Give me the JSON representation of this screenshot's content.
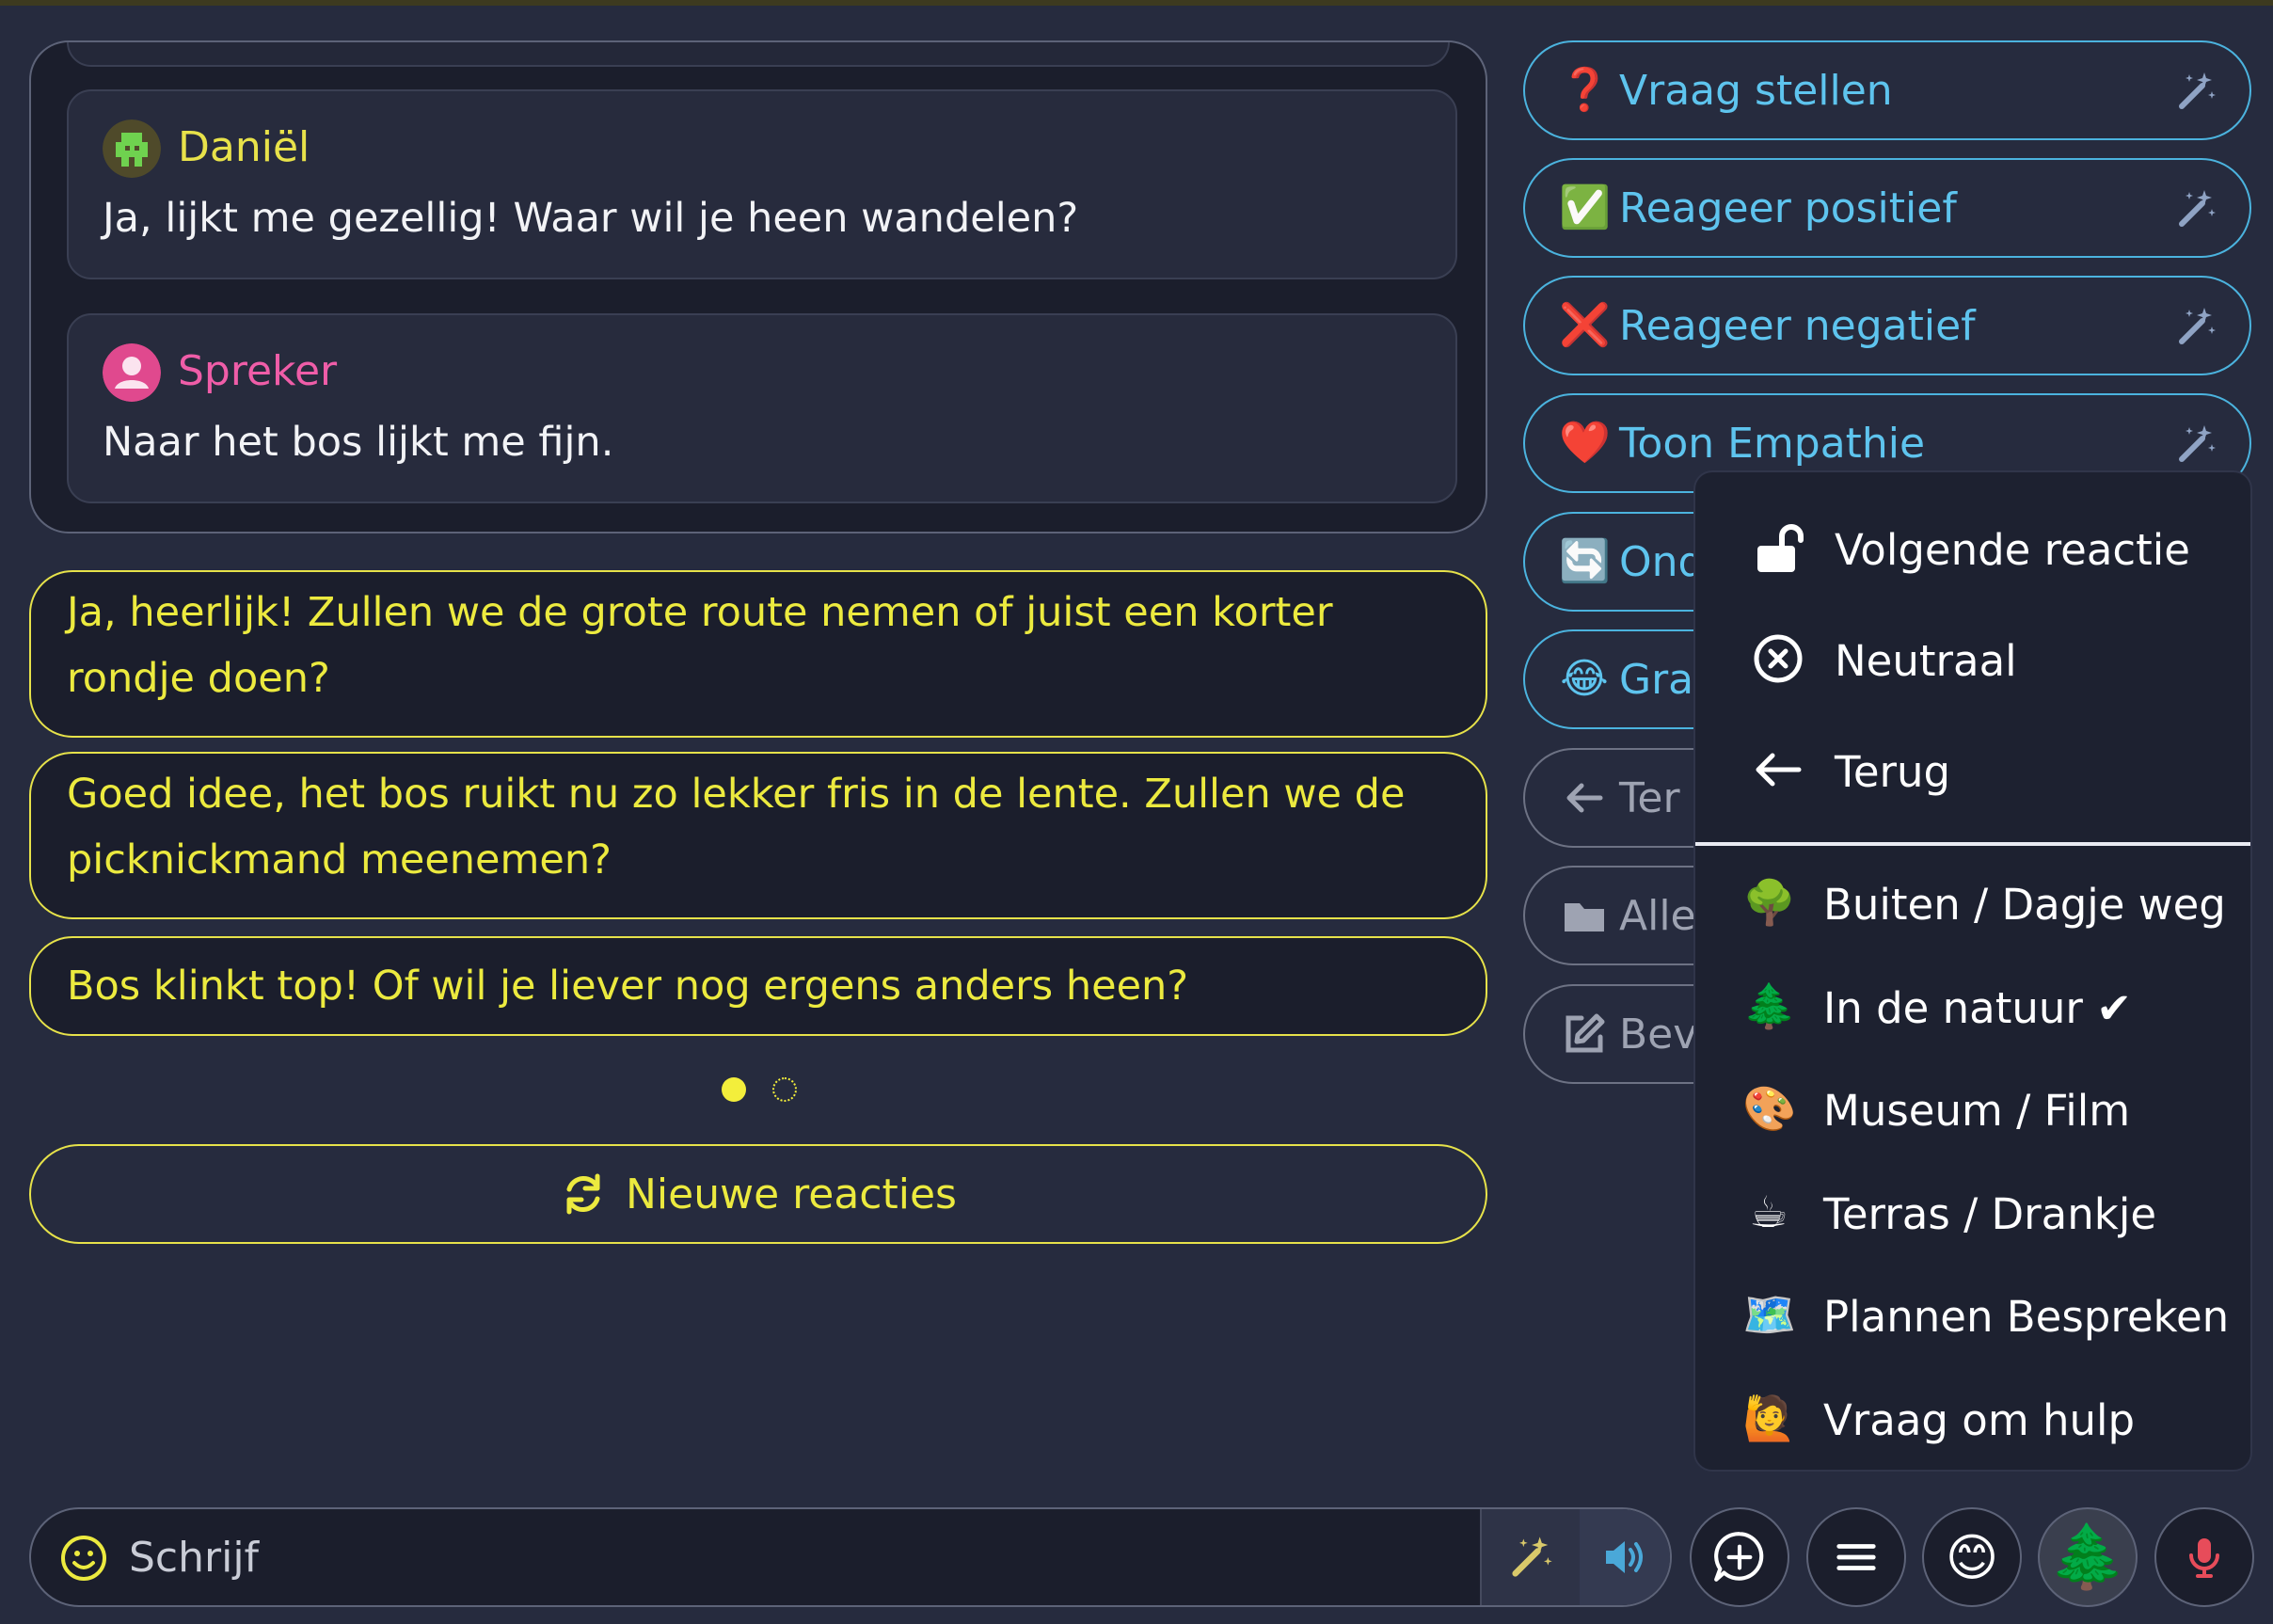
{
  "history": [
    {
      "name": "Daniël",
      "text": "Ja, lijkt me gezellig! Waar wil je heen wandelen?",
      "name_color": "#e8e24a"
    },
    {
      "name": "Spreker",
      "text": "Naar het bos lijkt me fijn.",
      "name_color": "#ef5da8"
    }
  ],
  "suggestions": [
    "Ja, heerlijk! Zullen we de grote route nemen of juist een korter rondje doen?",
    "Goed idee, het bos ruikt nu zo lekker fris in de lente. Zullen we de picknickmand meenemen?",
    "Bos klinkt top! Of wil je liever nog ergens anders heen?"
  ],
  "pager": {
    "current": 1,
    "total": 2
  },
  "new_replies_label": "Nieuwe reacties",
  "actions": [
    {
      "icon": "question-icon",
      "glyph": "❓",
      "label": "Vraag stellen",
      "magic": true
    },
    {
      "icon": "check-icon",
      "glyph": "✅",
      "label": "Reageer positief",
      "magic": true
    },
    {
      "icon": "cross-icon",
      "glyph": "❌",
      "label": "Reageer negatief",
      "magic": true
    },
    {
      "icon": "heart-icon",
      "glyph": "❤️",
      "label": "Toon Empathie",
      "magic": true
    },
    {
      "icon": "repeat-icon",
      "glyph": "🔄",
      "label": "Ond",
      "magic": false
    },
    {
      "icon": "laugh-icon",
      "glyph": "😂",
      "label": "Grap",
      "magic": false
    },
    {
      "icon": "arrow-left-icon",
      "glyph": "",
      "label": "Ter",
      "magic": false
    },
    {
      "icon": "folder-icon",
      "glyph": "",
      "label": "Alle",
      "magic": false
    },
    {
      "icon": "edit-icon",
      "glyph": "",
      "label": "Bev",
      "magic": false
    }
  ],
  "menu": {
    "top_items": [
      {
        "icon": "unlock-icon",
        "label": "Volgende reactie"
      },
      {
        "icon": "circle-x-icon",
        "label": "Neutraal"
      },
      {
        "icon": "arrow-left-icon",
        "label": "Terug"
      }
    ],
    "topics": [
      {
        "icon": "tree-icon",
        "glyph": "🌳",
        "label": "Buiten / Dagje weg"
      },
      {
        "icon": "evergreen-icon",
        "glyph": "🌲",
        "label": "In de natuur ✔"
      },
      {
        "icon": "palette-icon",
        "glyph": "🎨",
        "label": "Museum / Film"
      },
      {
        "icon": "coffee-icon",
        "glyph": "☕",
        "label": "Terras / Drankje"
      },
      {
        "icon": "map-icon",
        "glyph": "🗺️",
        "label": "Plannen Bespreken"
      },
      {
        "icon": "raised-hand-icon",
        "glyph": "🙋",
        "label": "Vraag om hulp"
      }
    ]
  },
  "input": {
    "placeholder": "Schrijf"
  },
  "bottom": {
    "topic_glyph": "🌲",
    "emoji_glyph": "😊"
  },
  "colors": {
    "accent_yellow": "#ecea3f",
    "accent_blue": "#5ec4ee",
    "background": "#262b3e"
  }
}
